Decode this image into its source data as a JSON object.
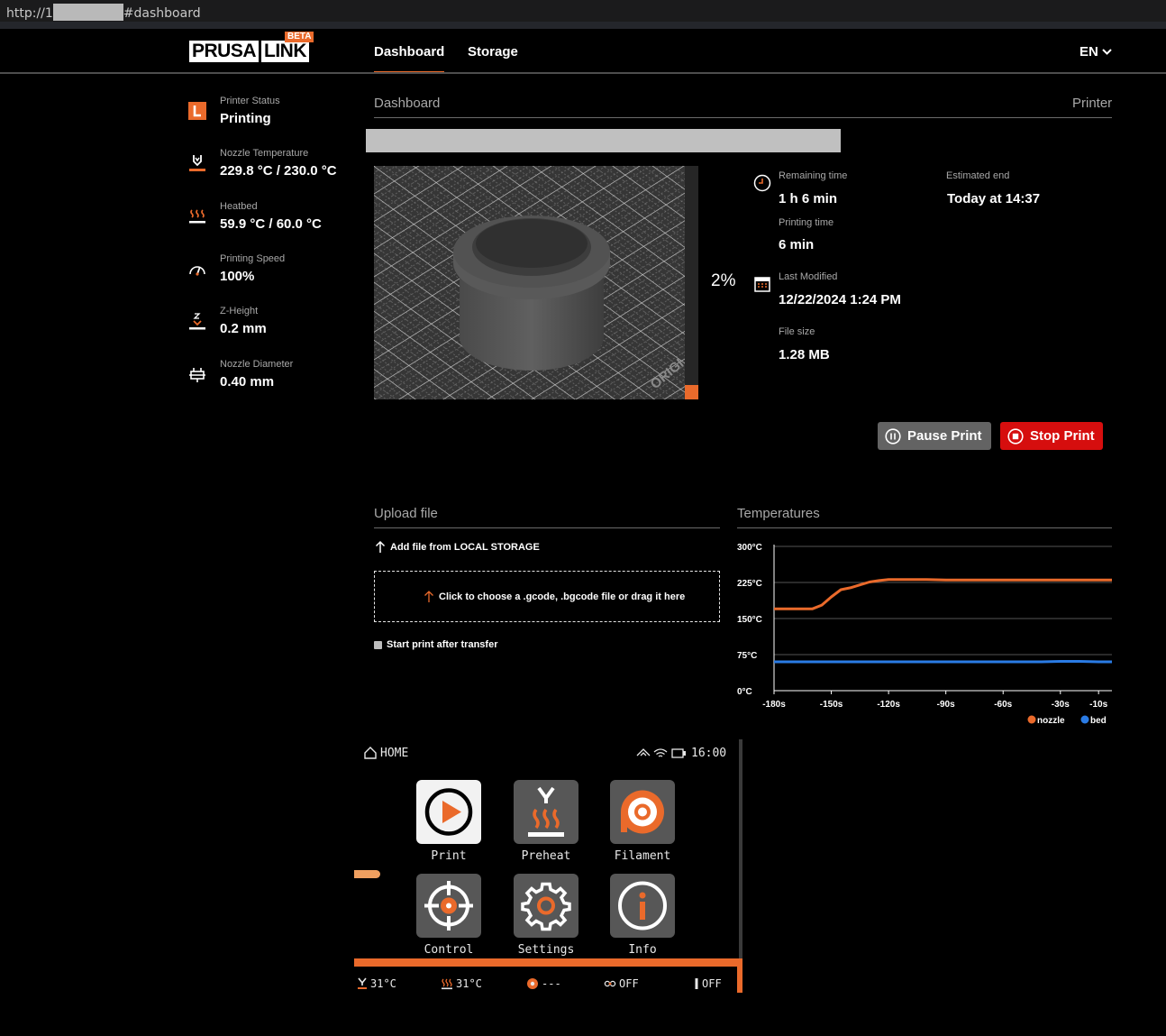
{
  "browser": {
    "url_prefix": "http://1",
    "url_suffix": "#dashboard"
  },
  "header": {
    "logo_left": "PRUSA",
    "logo_right": "LINK",
    "beta_badge": "BETA",
    "nav": [
      {
        "label": "Dashboard",
        "active": true
      },
      {
        "label": "Storage",
        "active": false
      }
    ],
    "language": "EN"
  },
  "sidebar": {
    "items": [
      {
        "icon": "printer-status-icon",
        "label": "Printer Status",
        "value": "Printing"
      },
      {
        "icon": "nozzle-icon",
        "label": "Nozzle Temperature",
        "value": "229.8 °C / 230.0 °C"
      },
      {
        "icon": "heatbed-icon",
        "label": "Heatbed",
        "value": "59.9 °C / 60.0 °C"
      },
      {
        "icon": "speedometer-icon",
        "label": "Printing Speed",
        "value": "100%"
      },
      {
        "icon": "z-height-icon",
        "label": "Z-Height",
        "value": "0.2 mm"
      },
      {
        "icon": "nozzle-diameter-icon",
        "label": "Nozzle Diameter",
        "value": "0.40 mm"
      }
    ]
  },
  "dashboard": {
    "title": "Dashboard",
    "right_title": "Printer",
    "progress": {
      "percent_value": 2,
      "label": "2%"
    },
    "preview_watermark": "ORIGI",
    "remaining_time": {
      "label": "Remaining time",
      "value": "1 h 6 min"
    },
    "estimated_end": {
      "label": "Estimated end",
      "value": "Today at 14:37"
    },
    "printing_time": {
      "label": "Printing time",
      "value": "6 min"
    },
    "last_modified": {
      "label": "Last Modified",
      "value": "12/22/2024 1:24 PM"
    },
    "file_size": {
      "label": "File size",
      "value": "1.28 MB"
    },
    "pause_label": "Pause Print",
    "stop_label": "Stop Print"
  },
  "upload": {
    "title": "Upload file",
    "local_label": "Add file from LOCAL STORAGE",
    "dropzone_text": "Click to choose a .gcode, .bgcode file or drag it here",
    "start_after_label": "Start print after transfer",
    "start_after_checked": false
  },
  "temperatures": {
    "title": "Temperatures"
  },
  "chart_data": {
    "type": "line",
    "title": "",
    "xlabel": "",
    "ylabel": "",
    "x": [
      -180,
      -175,
      -170,
      -165,
      -160,
      -155,
      -150,
      -145,
      -140,
      -135,
      -130,
      -125,
      -120,
      -115,
      -110,
      -100,
      -90,
      -80,
      -70,
      -60,
      -50,
      -40,
      -30,
      -20,
      -10,
      -3
    ],
    "x_ticks": [
      "-180s",
      "-150s",
      "-120s",
      "-90s",
      "-60s",
      "-30s",
      "-10s"
    ],
    "x_tick_values": [
      -180,
      -150,
      -120,
      -90,
      -60,
      -30,
      -10
    ],
    "y_ticks": [
      "0°C",
      "75°C",
      "150°C",
      "225°C",
      "300°C"
    ],
    "y_tick_values": [
      0,
      75,
      150,
      225,
      300
    ],
    "xlim": [
      -180,
      -3
    ],
    "ylim": [
      0,
      300
    ],
    "grid": true,
    "legend_position": "bottom-right",
    "series": [
      {
        "name": "nozzle",
        "color": "#ea6a2b",
        "values": [
          170,
          170,
          170,
          170,
          170,
          178,
          195,
          210,
          214,
          220,
          226,
          229,
          231,
          231,
          231,
          231,
          230,
          230,
          230,
          230,
          230,
          230,
          230,
          230,
          230,
          230
        ]
      },
      {
        "name": "bed",
        "color": "#2a7be4",
        "values": [
          60,
          60,
          60,
          60,
          60,
          60,
          60,
          60,
          60,
          60,
          60,
          60,
          60,
          60,
          60,
          60,
          60,
          60,
          60,
          60,
          60,
          60,
          61,
          61,
          60,
          60
        ]
      }
    ]
  },
  "lcd": {
    "home_label": "HOME",
    "time": "16:00",
    "tiles": [
      {
        "label": "Print",
        "icon": "play-icon",
        "active": true
      },
      {
        "label": "Preheat",
        "icon": "preheat-icon",
        "active": false
      },
      {
        "label": "Filament",
        "icon": "filament-icon",
        "active": false
      },
      {
        "label": "Control",
        "icon": "crosshair-icon",
        "active": false
      },
      {
        "label": "Settings",
        "icon": "gear-icon",
        "active": false
      },
      {
        "label": "Info",
        "icon": "info-icon",
        "active": false
      }
    ],
    "footer": {
      "nozzle_temp": "31°C",
      "bed_temp": "31°C",
      "filament": "---",
      "fan": "OFF",
      "z_axis": "OFF"
    }
  },
  "colors": {
    "accent": "#ea6a2b",
    "stop": "#d60e0e",
    "pause": "#636363",
    "bed_series": "#2a7be4"
  }
}
